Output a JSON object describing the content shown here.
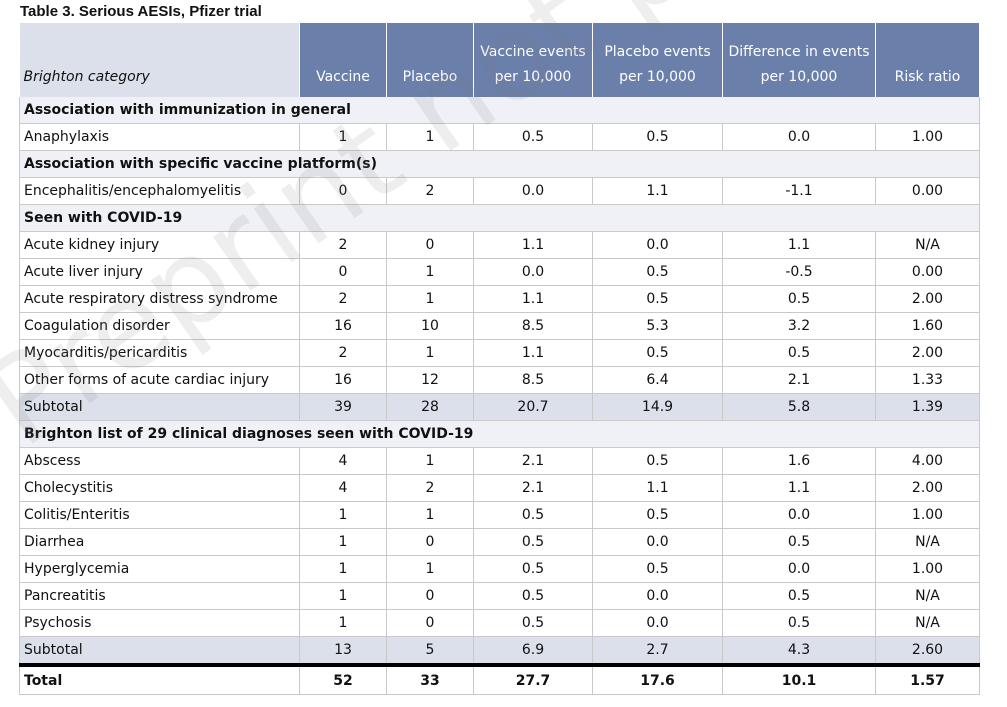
{
  "caption": "Table 3. Serious AESIs, Pfizer trial",
  "watermark": "Preprint not peer reviewed",
  "headers": [
    "Brighton category",
    "Vaccine",
    "Placebo",
    "Vaccine events per 10,000",
    "Placebo events per 10,000",
    "Difference in events per 10,000",
    "Risk ratio"
  ],
  "sections": [
    {
      "title": "Association with immunization in general",
      "rows": [
        [
          "Anaphylaxis",
          "1",
          "1",
          "0.5",
          "0.5",
          "0.0",
          "1.00"
        ]
      ]
    },
    {
      "title": "Association with specific vaccine platform(s)",
      "rows": [
        [
          "Encephalitis/encephalomyelitis",
          "0",
          "2",
          "0.0",
          "1.1",
          "-1.1",
          "0.00"
        ]
      ]
    },
    {
      "title": "Seen with COVID-19",
      "rows": [
        [
          "Acute kidney injury",
          "2",
          "0",
          "1.1",
          "0.0",
          "1.1",
          "N/A"
        ],
        [
          "Acute liver injury",
          "0",
          "1",
          "0.0",
          "0.5",
          "-0.5",
          "0.00"
        ],
        [
          "Acute respiratory distress syndrome",
          "2",
          "1",
          "1.1",
          "0.5",
          "0.5",
          "2.00"
        ],
        [
          "Coagulation disorder",
          "16",
          "10",
          "8.5",
          "5.3",
          "3.2",
          "1.60"
        ],
        [
          "Myocarditis/pericarditis",
          "2",
          "1",
          "1.1",
          "0.5",
          "0.5",
          "2.00"
        ],
        [
          "Other forms of acute cardiac injury",
          "16",
          "12",
          "8.5",
          "6.4",
          "2.1",
          "1.33"
        ]
      ],
      "subtotal": [
        "Subtotal",
        "39",
        "28",
        "20.7",
        "14.9",
        "5.8",
        "1.39"
      ]
    },
    {
      "title": "Brighton list of 29 clinical diagnoses seen with COVID-19",
      "rows": [
        [
          "Abscess",
          "4",
          "1",
          "2.1",
          "0.5",
          "1.6",
          "4.00"
        ],
        [
          "Cholecystitis",
          "4",
          "2",
          "2.1",
          "1.1",
          "1.1",
          "2.00"
        ],
        [
          "Colitis/Enteritis",
          "1",
          "1",
          "0.5",
          "0.5",
          "0.0",
          "1.00"
        ],
        [
          "Diarrhea",
          "1",
          "0",
          "0.5",
          "0.0",
          "0.5",
          "N/A"
        ],
        [
          "Hyperglycemia",
          "1",
          "1",
          "0.5",
          "0.5",
          "0.0",
          "1.00"
        ],
        [
          "Pancreatitis",
          "1",
          "0",
          "0.5",
          "0.0",
          "0.5",
          "N/A"
        ],
        [
          "Psychosis",
          "1",
          "0",
          "0.5",
          "0.0",
          "0.5",
          "N/A"
        ]
      ],
      "subtotal": [
        "Subtotal",
        "13",
        "5",
        "6.9",
        "2.7",
        "4.3",
        "2.60"
      ]
    }
  ],
  "total": [
    "Total",
    "52",
    "33",
    "27.7",
    "17.6",
    "10.1",
    "1.57"
  ]
}
